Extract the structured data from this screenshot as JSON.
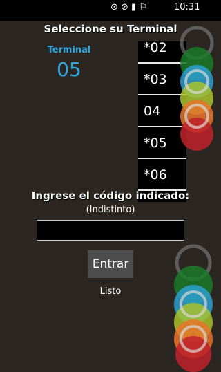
{
  "statusbar": {
    "icons": "⊙ ⊘ ▮ ⚐",
    "clock": "10:31"
  },
  "header": {
    "title": "Seleccione su Terminal"
  },
  "terminal": {
    "label": "Terminal",
    "value": "05"
  },
  "picker": {
    "items": [
      "*02",
      "*03",
      "04",
      "*05",
      "*06"
    ]
  },
  "form": {
    "prompt": "Ingrese el código indicado:",
    "hint": "(Indistinto)",
    "input_value": "",
    "button_label": "Entrar",
    "status": "Listo"
  },
  "decoration_colors": [
    "#1b7a2a",
    "#2b9fd0",
    "#a9c22b",
    "#e8742a",
    "#c0222a"
  ]
}
